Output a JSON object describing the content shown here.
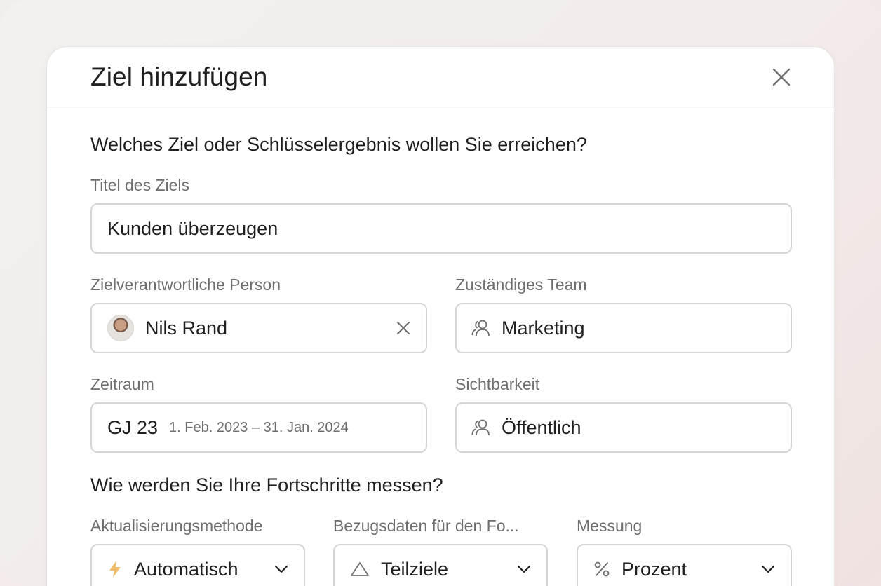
{
  "dialog": {
    "title": "Ziel hinzufügen",
    "close_icon": "close-icon"
  },
  "section_goal": {
    "heading": "Welches Ziel oder Schlüsselergebnis wollen Sie erreichen?",
    "title_label": "Titel des Ziels",
    "title_value": "Kunden überzeugen",
    "owner_label": "Zielverantwortliche Person",
    "owner_value": "Nils Rand",
    "team_label": "Zuständiges Team",
    "team_value": "Marketing",
    "period_label": "Zeitraum",
    "period_value": "GJ 23",
    "period_range": "1. Feb. 2023 – 31. Jan. 2024",
    "visibility_label": "Sichtbarkeit",
    "visibility_value": "Öffentlich"
  },
  "section_progress": {
    "heading": "Wie werden Sie Ihre Fortschritte messen?",
    "update_label": "Aktualisierungsmethode",
    "update_value": "Automatisch",
    "source_label": "Bezugsdaten für den Fo...",
    "source_value": "Teilziele",
    "measure_label": "Messung",
    "measure_value": "Prozent"
  },
  "icons": {
    "team": "people-icon",
    "visibility": "people-icon",
    "update": "lightning-icon",
    "source": "triangle-icon",
    "measure": "percent-icon",
    "dropdown": "chevron-down-icon",
    "clear": "close-icon"
  },
  "colors": {
    "accent_lightning": "#f1bd6c",
    "border": "#d6d5d3",
    "label": "#6d6e6f",
    "text": "#1e1f21"
  }
}
